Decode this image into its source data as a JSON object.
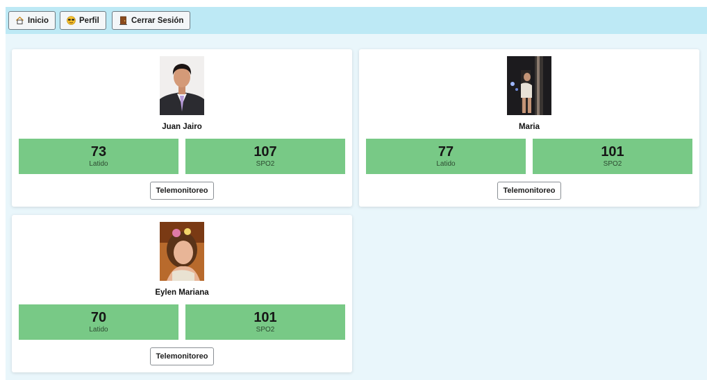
{
  "nav": {
    "inicio": {
      "label": "Inicio",
      "icon": "home-icon"
    },
    "perfil": {
      "label": "Perfil",
      "icon": "sunglasses-face-icon"
    },
    "logout": {
      "label": "Cerrar Sesión",
      "icon": "door-icon"
    }
  },
  "patients": [
    {
      "name": "Juan Jairo",
      "heart_rate": "73",
      "heart_rate_label": "Latido",
      "spo2": "107",
      "spo2_label": "SPO2",
      "button": "Telemonitoreo"
    },
    {
      "name": "Maria",
      "heart_rate": "77",
      "heart_rate_label": "Latido",
      "spo2": "101",
      "spo2_label": "SPO2",
      "button": "Telemonitoreo"
    },
    {
      "name": "Eylen Mariana",
      "heart_rate": "70",
      "heart_rate_label": "Latido",
      "spo2": "101",
      "spo2_label": "SPO2",
      "button": "Telemonitoreo"
    }
  ],
  "colors": {
    "navbar": "#bde9f5",
    "page_background": "#e9f6fb",
    "stat_tile": "#78c986"
  }
}
